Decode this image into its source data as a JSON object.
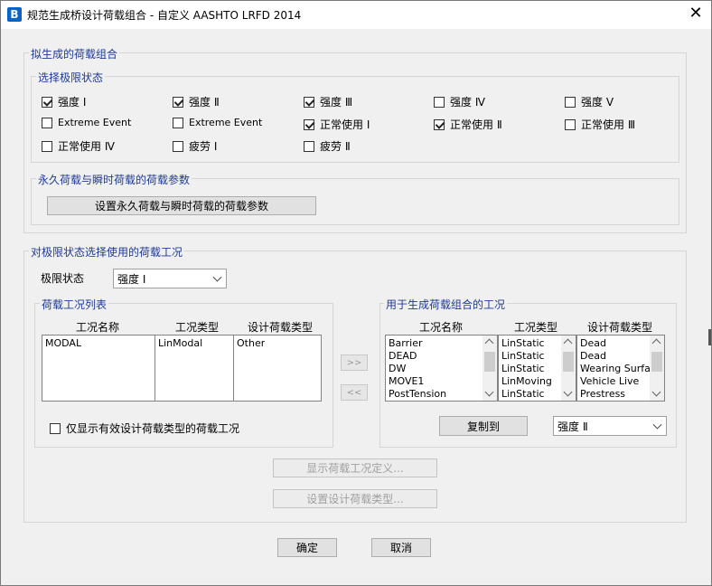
{
  "window": {
    "title": "规范生成桥设计荷载组合 - 自定义 AASHTO LRFD 2014",
    "app_icon": "B"
  },
  "generated_combos": {
    "title": "拟生成的荷载组合",
    "limit_states": {
      "title": "选择极限状态",
      "items": [
        {
          "label": "强度 Ⅰ",
          "checked": true
        },
        {
          "label": "强度 Ⅱ",
          "checked": true
        },
        {
          "label": "强度 Ⅲ",
          "checked": true
        },
        {
          "label": "强度 Ⅳ",
          "checked": false
        },
        {
          "label": "强度 Ⅴ",
          "checked": false
        },
        {
          "label": "Extreme Event",
          "checked": false
        },
        {
          "label": "Extreme Event",
          "checked": false
        },
        {
          "label": "正常使用 Ⅰ",
          "checked": true
        },
        {
          "label": "正常使用 Ⅱ",
          "checked": true
        },
        {
          "label": "正常使用 Ⅲ",
          "checked": false
        },
        {
          "label": "正常使用 Ⅳ",
          "checked": false
        },
        {
          "label": "疲劳 Ⅰ",
          "checked": false
        },
        {
          "label": "疲劳 Ⅱ",
          "checked": false
        }
      ]
    },
    "params": {
      "title": "永久荷载与瞬时荷载的荷载参数",
      "button": "设置永久荷载与瞬时荷载的荷载参数"
    }
  },
  "case_select": {
    "title": "对极限状态选择使用的荷载工况",
    "limit_state_label": "极限状态",
    "limit_state_value": "强度 Ⅰ",
    "case_list": {
      "title": "荷载工况列表",
      "headers": [
        "工况名称",
        "工况类型",
        "设计荷载类型"
      ],
      "rows": [
        [
          "MODAL",
          "LinModal",
          "Other"
        ]
      ]
    },
    "add_button": ">>",
    "remove_button": "<<",
    "show_valid_only": {
      "label": "仅显示有效设计荷载类型的荷载工况",
      "checked": false
    },
    "used_cases": {
      "title": "用于生成荷载组合的工况",
      "headers": [
        "工况名称",
        "工况类型",
        "设计荷载类型"
      ],
      "names": [
        "Barrier",
        "DEAD",
        "DW",
        "MOVE1",
        "PostTension"
      ],
      "types": [
        "LinStatic",
        "LinStatic",
        "LinStatic",
        "LinMoving",
        "LinStatic"
      ],
      "design_types": [
        "Dead",
        "Dead",
        "Wearing Surfac",
        "Vehicle Live",
        "Prestress"
      ]
    },
    "copy_to_button": "复制到",
    "copy_to_value": "强度 Ⅱ",
    "show_case_def_button": "显示荷载工况定义...",
    "set_design_type_button": "设置设计荷载类型..."
  },
  "footer": {
    "ok": "确定",
    "cancel": "取消"
  }
}
